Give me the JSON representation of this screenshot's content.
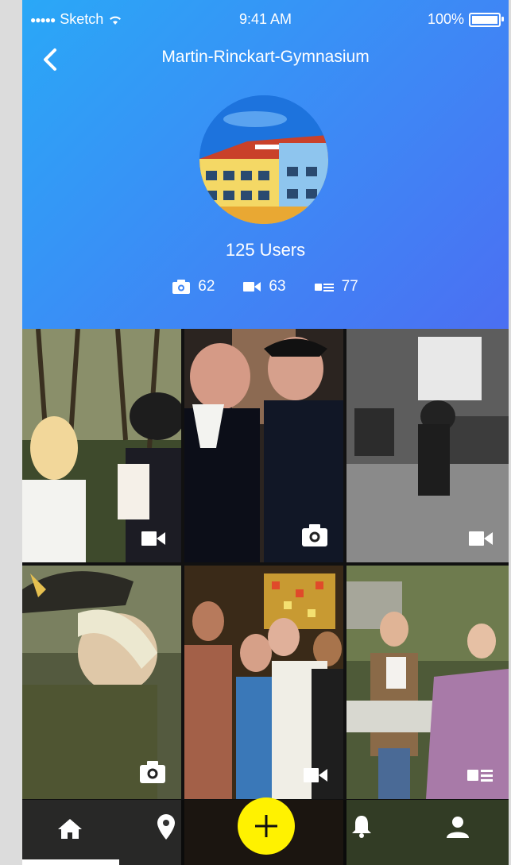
{
  "status_bar": {
    "carrier": "Sketch",
    "time": "9:41 AM",
    "battery": "100%"
  },
  "nav": {
    "title": "Martin-Rinckart-Gymnasium",
    "back_icon": "chevron-left-icon"
  },
  "profile": {
    "users_label": "125 Users",
    "stats": [
      {
        "icon": "camera-icon",
        "count": "62"
      },
      {
        "icon": "video-icon",
        "count": "63"
      },
      {
        "icon": "article-icon",
        "count": "77"
      }
    ]
  },
  "grid": {
    "tiles": [
      {
        "media": "video-icon"
      },
      {
        "media": "camera-icon"
      },
      {
        "media": "video-icon"
      },
      {
        "media": "camera-icon"
      },
      {
        "media": "video-icon"
      },
      {
        "media": "article-icon"
      }
    ]
  },
  "tab_bar": {
    "items": [
      "home-icon",
      "location-pin-icon",
      "add-icon",
      "bell-icon",
      "profile-icon"
    ]
  },
  "colors": {
    "header_gradient_start": "#2aa8f7",
    "header_gradient_end": "#4b6ff2",
    "fab": "#fff200"
  }
}
